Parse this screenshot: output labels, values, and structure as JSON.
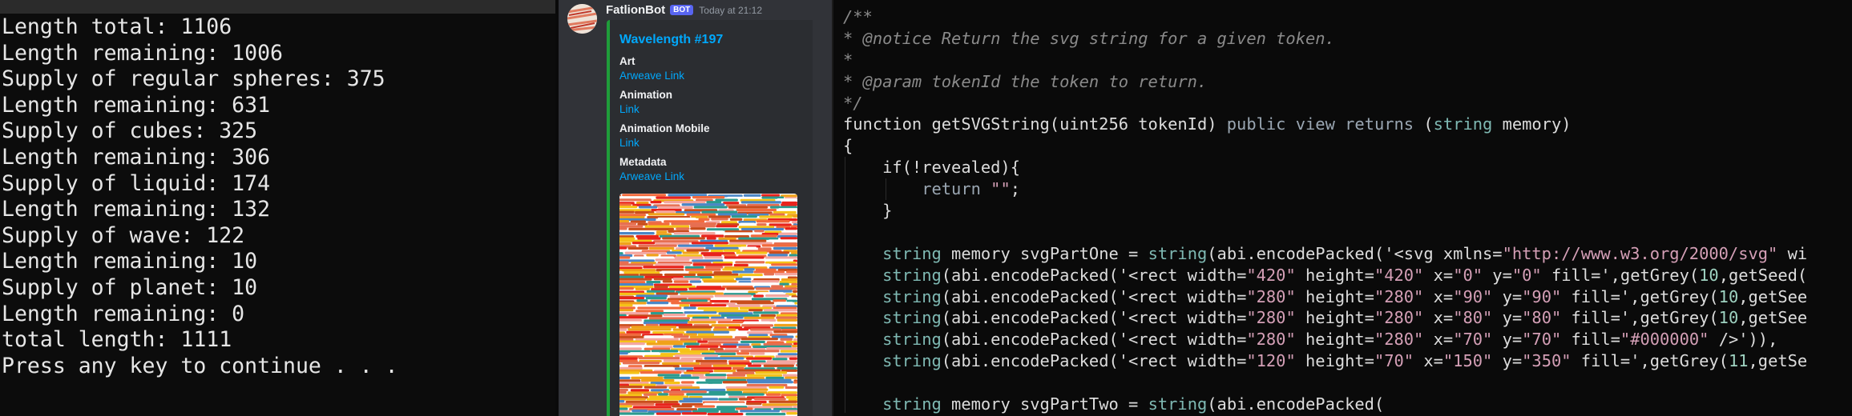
{
  "terminal": {
    "lines": [
      "Length total: 1106",
      "Length remaining: 1006",
      "Supply of regular spheres: 375",
      "Length remaining: 631",
      "Supply of cubes: 325",
      "Length remaining: 306",
      "Supply of liquid: 174",
      "Length remaining: 132",
      "Supply of wave: 122",
      "Length remaining: 10",
      "Supply of planet: 10",
      "Length remaining: 0",
      "total length: 1111",
      "Press any key to continue . . ."
    ]
  },
  "discord": {
    "author": "FatlionBot",
    "badge": "BOT",
    "timestamp": "Today at 21:12",
    "accent_color": "#1f9d3a",
    "embed": {
      "title": "Wavelength #197",
      "fields": [
        {
          "name": "Art",
          "value": "Arweave Link"
        },
        {
          "name": "Animation",
          "value": "Link"
        },
        {
          "name": "Animation Mobile",
          "value": "Link"
        },
        {
          "name": "Metadata",
          "value": "Arweave Link"
        }
      ],
      "image_palette": [
        "#e8231c",
        "#f0a21a",
        "#f26a3d",
        "#ffffff",
        "#2b9b8f",
        "#4a86c6",
        "#f5c218",
        "#e76f51",
        "#c94d1c",
        "#f4a6a0"
      ]
    }
  },
  "code": {
    "lines": [
      "/**",
      "* @notice Return the svg string for a given token.",
      "*",
      "* @param tokenId the token to return.",
      "*/",
      "function getSVGString(uint256 tokenId) public view returns (string memory)",
      "{",
      "    if(!revealed){",
      "        return \"\";",
      "    }",
      "",
      "    string memory svgPartOne = string(abi.encodePacked('<svg xmlns=\"http://www.w3.org/2000/svg\" wi",
      "    string(abi.encodePacked('<rect width=\"420\" height=\"420\" x=\"0\" y=\"0\" fill=',getGrey(10,getSeed(",
      "    string(abi.encodePacked('<rect width=\"280\" height=\"280\" x=\"90\" y=\"90\" fill=',getGrey(10,getSee",
      "    string(abi.encodePacked('<rect width=\"280\" height=\"280\" x=\"80\" y=\"80\" fill=',getGrey(10,getSee",
      "    string(abi.encodePacked('<rect width=\"280\" height=\"280\" x=\"70\" y=\"70\" fill=\"#000000\" />')),",
      "    string(abi.encodePacked('<rect width=\"120\" height=\"70\" x=\"150\" y=\"350\" fill=',getGrey(11,getSe",
      "",
      "    string memory svgPartTwo = string(abi.encodePacked("
    ]
  }
}
